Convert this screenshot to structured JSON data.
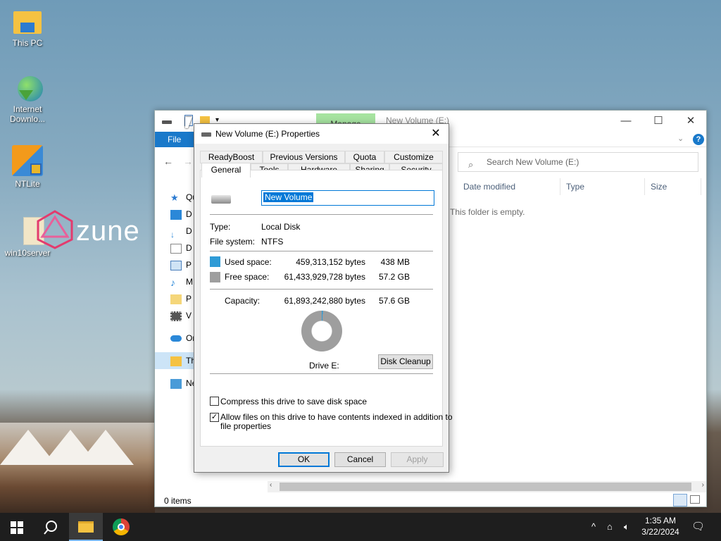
{
  "desktop": {
    "icons": [
      {
        "label": "This PC"
      },
      {
        "label": "Internet Downlo..."
      },
      {
        "label": "NTLite"
      },
      {
        "label": "win10server"
      }
    ],
    "wallpaper_text": "zune"
  },
  "explorer": {
    "title": "New Volume (E:)",
    "manage_tab": "Manage",
    "file_tab": "File",
    "search_placeholder": "Search New Volume (E:)",
    "columns": [
      "Date modified",
      "Type",
      "Size"
    ],
    "empty_message": "This folder is empty.",
    "nav_items": [
      "Qu",
      "D",
      "D",
      "D",
      "P",
      "M",
      "P",
      "V",
      "On",
      "Th",
      "Ne"
    ],
    "status": "0 items"
  },
  "dialog": {
    "title": "New Volume (E:) Properties",
    "tabs_row1": [
      "ReadyBoost",
      "Previous Versions",
      "Quota",
      "Customize"
    ],
    "tabs_row2": [
      "General",
      "Tools",
      "Hardware",
      "Sharing",
      "Security"
    ],
    "active_tab": "General",
    "volume_name": "New Volume",
    "type_label": "Type:",
    "type_value": "Local Disk",
    "fs_label": "File system:",
    "fs_value": "NTFS",
    "used_label": "Used space:",
    "used_bytes": "459,313,152 bytes",
    "used_size": "438 MB",
    "free_label": "Free space:",
    "free_bytes": "61,433,929,728 bytes",
    "free_size": "57.2 GB",
    "capacity_label": "Capacity:",
    "capacity_bytes": "61,893,242,880 bytes",
    "capacity_size": "57.6 GB",
    "drive_label": "Drive E:",
    "disk_cleanup": "Disk Cleanup",
    "compress_label": "Compress this drive to save disk space",
    "compress_checked": false,
    "index_label_1": "Allow files on this drive to have contents indexed in addition to",
    "index_label_2": "file properties",
    "index_checked": true,
    "ok": "OK",
    "cancel": "Cancel",
    "apply": "Apply",
    "used_color": "#2f9bd6",
    "free_color": "#9e9e9e"
  },
  "taskbar": {
    "time": "1:35 AM",
    "date": "3/22/2024"
  }
}
